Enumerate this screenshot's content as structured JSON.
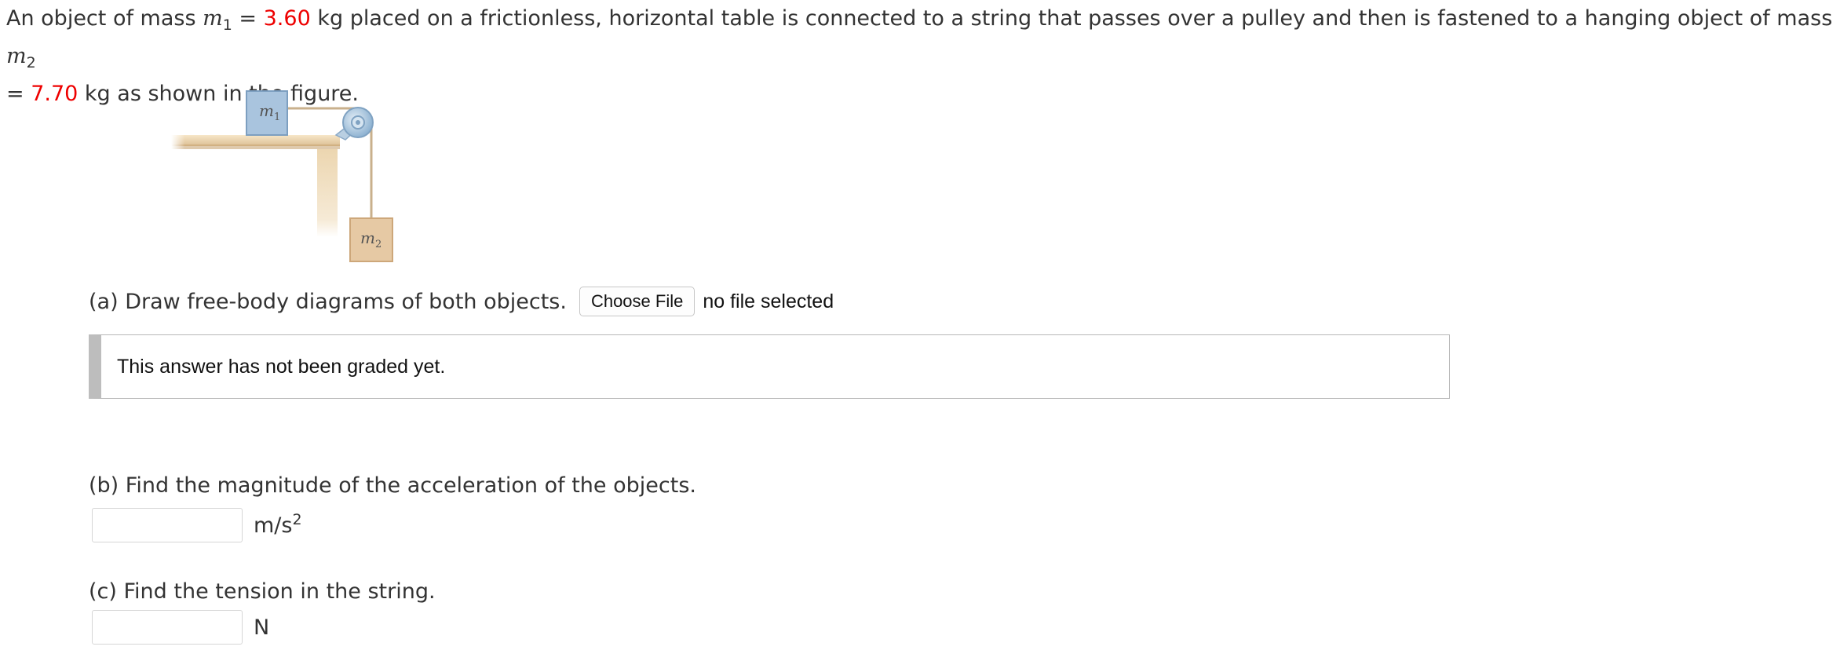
{
  "problem": {
    "intro": "An object of mass ",
    "m1_symbol": "m",
    "m1_sub": "1",
    "eq1": " = ",
    "m1_value": "3.60",
    "mid": " kg placed on a frictionless, horizontal table is connected to a string that passes over a pulley and then is fastened to a hanging object of mass ",
    "m2_symbol": "m",
    "m2_sub": "2",
    "eq2": "= ",
    "m2_value": "7.70",
    "end": " kg as shown in the figure."
  },
  "figure": {
    "m1_label": "m",
    "m1_sub": "1",
    "m2_label": "m",
    "m2_sub": "2"
  },
  "part_a": {
    "prompt": "(a) Draw free-body diagrams of both objects.",
    "choose_file_label": "Choose File",
    "file_status": "no file selected",
    "graded_message": "This answer has not been graded yet."
  },
  "part_b": {
    "prompt": "(b) Find the magnitude of the acceleration of the objects.",
    "input_value": "",
    "unit": "m/s",
    "unit_exp": "2"
  },
  "part_c": {
    "prompt": "(c) Find the tension in the string.",
    "input_value": "",
    "unit": "N"
  },
  "colors": {
    "given_value": "#ee0000",
    "text": "#333333",
    "block_m1": "#a9c4de",
    "block_m2": "#e6c9a4",
    "table_wood": "#efd9b4"
  }
}
